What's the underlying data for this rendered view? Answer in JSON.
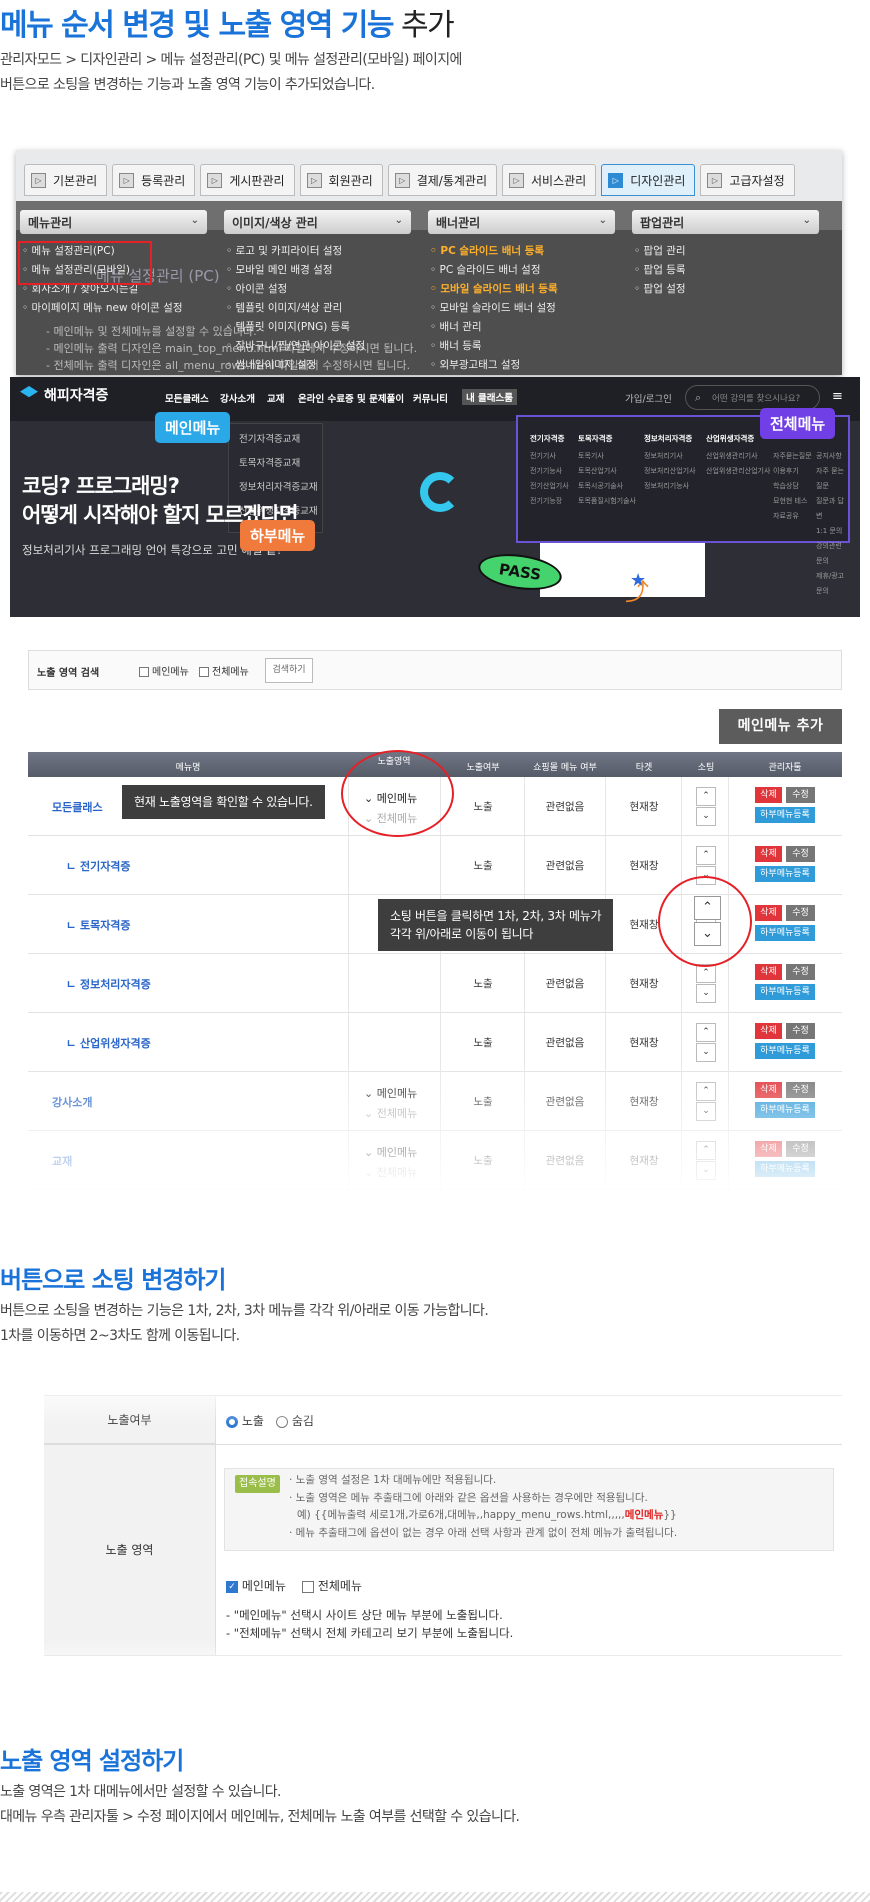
{
  "header": {
    "title_bold": "메뉴 순서 변경 및 노출 영역 기능",
    "title_rest": " 추가",
    "desc_line1": "관리자모드 > 디자인관리 > 메뉴 설정관리(PC) 및 메뉴 설정관리(모바일) 페이지에",
    "desc_line2": "버튼으로 소팅을 변경하는 기능과 노출 영역 기능이 추가되었습니다."
  },
  "admin": {
    "tabs": [
      "기본관리",
      "등록관리",
      "게시판관리",
      "회원관리",
      "결제/통계관리",
      "서비스관리",
      "디자인관리",
      "고급자설정"
    ],
    "menu_heads": [
      "메뉴관리",
      "이미지/색상 관리",
      "배너관리",
      "팝업관리"
    ],
    "col1": [
      "메뉴 설정관리(PC)",
      "메뉴 설정관리(모바일)",
      "회사소개 / 찾아오시는길",
      "마이페이지 메뉴 new 아이콘 설정"
    ],
    "col2": [
      "로고 및 카피라이터 설정",
      "모바일 메인 배경 설정",
      "아이콘 설정",
      "템플릿 이미지/색상 관리",
      "템플릿 이미지(PNG) 등록",
      "장바구니/찜/연관 아이콘 설정",
      "썸네일이미지 설정"
    ],
    "col3": [
      "PC 슬라이드 배너 등록",
      "PC 슬라이드 배너 설정",
      "모바일 슬라이드 배너 등록",
      "모바일 슬라이드 배너 설정",
      "배너 관리",
      "배너 등록",
      "외부광고태그 설정"
    ],
    "col4": [
      "팝업 관리",
      "팝업 등록",
      "팝업 설정"
    ],
    "bg_title": "메뉴 설정관리 (PC)",
    "bg_lines": [
      "- 메인메뉴 및 전체메뉴를 설정할 수 있습니다.",
      "- 메인메뉴 출력 디자인은 main_top_menu.html 파일에서 수정하시면 됩니다.",
      "- 전체메뉴 출력 디자인은 all_menu_rows.html 파일에서 수정하시면 됩니다."
    ]
  },
  "site": {
    "logo": "해피자격증",
    "nav": [
      "모든클래스",
      "강사소개",
      "교재",
      "온라인 수료증 및 문제풀이",
      "커뮤니티",
      "내 클래스룸"
    ],
    "login": "가입/로그인",
    "search_placeholder": "어떤 강의를 찾으시나요?",
    "dropdown": [
      "전기자격증교재",
      "토목자격증교재",
      "정보처리자격증교재",
      "산업위생자격증교재"
    ],
    "hero_line1": "코딩? 프로그래밍?",
    "hero_line2": "어떻게 시작해야 할지 모르겠다면",
    "hero_sub": "정보처리기사 프로그래밍 언어 특강으로 고민 해결 끝!",
    "tag_main": "메인메뉴",
    "tag_all": "전체메뉴",
    "tag_sub": "하부메뉴",
    "pass": "PASS",
    "all_cols": [
      {
        "head": "전기자격증",
        "items": [
          "전기기사",
          "전기기능사",
          "전기산업기사",
          "전기기능장"
        ]
      },
      {
        "head": "토목자격증",
        "items": [
          "토목기사",
          "토목산업기사",
          "토목시공기술사",
          "토목품질시험기술사"
        ]
      },
      {
        "head": "정보처리자격증",
        "items": [
          "정보처리기사",
          "정보처리산업기사",
          "정보처리기능사"
        ]
      },
      {
        "head": "산업위생자격증",
        "items": [
          "산업위생관리기사",
          "산업위생관리산업기사"
        ]
      },
      {
        "head": "",
        "items": [
          "자주묻는질문",
          "이용후기",
          "학습상담",
          "묘현현 테스",
          "자료공유"
        ]
      },
      {
        "head": "",
        "items": [
          "공지사항",
          "자주 묻는 질문",
          "질문과 답변",
          "1:1 문의",
          "강의관련 문의",
          "제휴/광고문의"
        ]
      }
    ]
  },
  "search": {
    "label": "노출 영역 검색",
    "opt_main": "메인메뉴",
    "opt_all": "전체메뉴",
    "button": "검색하기"
  },
  "add_button": "메인메뉴 추가",
  "table": {
    "headers": [
      "메뉴명",
      "노출영역",
      "노출여부",
      "쇼핑몰 메뉴 여부",
      "타겟",
      "소팅",
      "관리자툴"
    ],
    "rows": [
      {
        "name": "모든클래스",
        "area1": "메인메뉴",
        "area2": "전체메뉴",
        "show": "노출",
        "mall": "관련없음",
        "target": "현재창"
      },
      {
        "name": "ㄴ 전기자격증",
        "area1": "",
        "area2": "",
        "show": "노출",
        "mall": "관련없음",
        "target": "현재창"
      },
      {
        "name": "ㄴ 토목자격증",
        "area1": "",
        "area2": "",
        "show": "노출",
        "mall": "관련없음",
        "target": "현재창"
      },
      {
        "name": "ㄴ 정보처리자격증",
        "area1": "",
        "area2": "",
        "show": "노출",
        "mall": "관련없음",
        "target": "현재창"
      },
      {
        "name": "ㄴ 산업위생자격증",
        "area1": "",
        "area2": "",
        "show": "노출",
        "mall": "관련없음",
        "target": "현재창"
      },
      {
        "name": "강사소개",
        "area1": "메인메뉴",
        "area2": "전체메뉴",
        "show": "노출",
        "mall": "관련없음",
        "target": "현재창"
      },
      {
        "name": "교재",
        "area1": "메인메뉴",
        "area2": "전체메뉴",
        "show": "노출",
        "mall": "관련없음",
        "target": "현재창"
      }
    ],
    "btn_delete": "삭제",
    "btn_edit": "수정",
    "btn_sub": "하부메뉴등록",
    "tip_area": "현재 노출영역을 확인할 수 있습니다.",
    "tip_sort_1": "소팅 버튼을 클릭하면 1차, 2차, 3차 메뉴가",
    "tip_sort_2": "각각 위/아래로 이동이 됩니다"
  },
  "section2": {
    "title": "버튼으로 소팅 변경하기",
    "line1": "버튼으로 소팅을 변경하는 기능은 1차, 2차, 3차 메뉴를 각각 위/아래로 이동 가능합니다.",
    "line2": "1차를 이동하면 2~3차도 함께 이동됩니다."
  },
  "form": {
    "label_show": "노출여부",
    "radio_show": "노출",
    "radio_hide": "숨김",
    "label_area": "노출 영역",
    "badge": "접속설명",
    "guide": [
      "· 노출 영역 설정은 1차 대메뉴에만 적용됩니다.",
      "· 노출 영역은 메뉴 추출태그에 아래와 같은 옵션을 사용하는 경우에만 적용됩니다.",
      "예) {{메뉴출력 세로1개,가로6개,대메뉴,,happy_menu_rows.html,,,,,",
      "메인메뉴",
      "}}",
      "· 메뉴 추출태그에 옵션이 없는 경우 아래 선택 사항과 관계 없이 전체 메뉴가 출력됩니다."
    ],
    "chk_main": "메인메뉴",
    "chk_all": "전체메뉴",
    "note1": "- \"메인메뉴\" 선택시 사이트 상단 메뉴 부분에 노출됩니다.",
    "note2": "- \"전체메뉴\" 선택시 전체 카테고리 보기 부분에 노출됩니다."
  },
  "section3": {
    "title": "노출 영역 설정하기",
    "line1": "노출 영역은 1차 대메뉴에서만 설정할 수 있습니다.",
    "line2": "대메뉴 우측 관리자툴 > 수정 페이지에서 메인메뉴, 전체메뉴 노출 여부를 선택할 수 있습니다."
  },
  "colors": {
    "accent": "#1a73d9",
    "danger": "#e52127",
    "main_tag": "#2aa8e8",
    "all_tag": "#7040e6",
    "sub_tag": "#ef7a3c"
  }
}
